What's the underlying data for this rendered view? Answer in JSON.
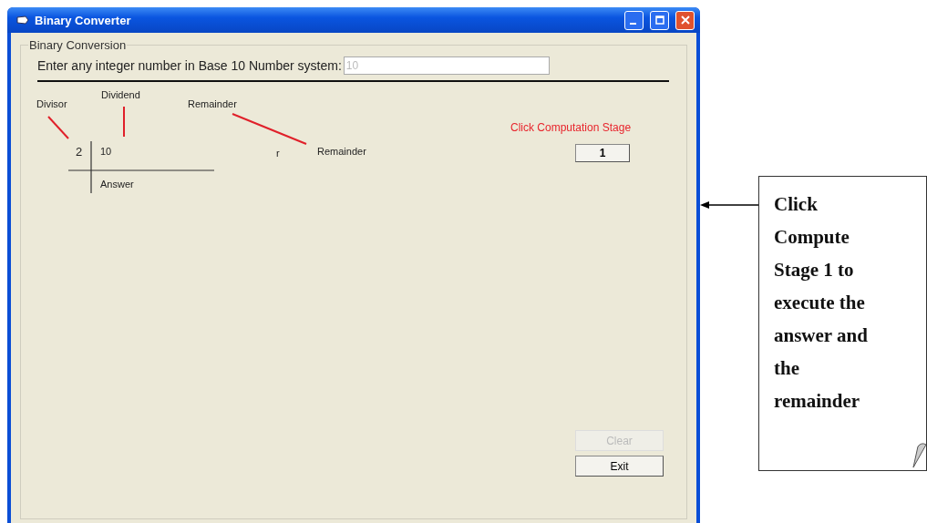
{
  "window": {
    "title": "Binary Converter"
  },
  "group": {
    "title": "Binary Conversion"
  },
  "prompt": {
    "label": "Enter any integer number in Base 10 Number system:",
    "value": "10",
    "disabled": true
  },
  "diagram": {
    "labels": [
      "Divisor",
      "Dividend",
      "Remainder"
    ],
    "divisor": "2",
    "dividend": "10",
    "answer": "Answer",
    "remainder_mark": "r",
    "remainder": "Remainder"
  },
  "stage": {
    "hint": "Click Computation Stage",
    "button": "1"
  },
  "buttons": [
    {
      "label": "Clear",
      "disabled": true
    },
    {
      "label": "Exit",
      "disabled": false
    }
  ],
  "callout": {
    "text": "Click Compute Stage 1 to execute the answer and the remainder"
  }
}
